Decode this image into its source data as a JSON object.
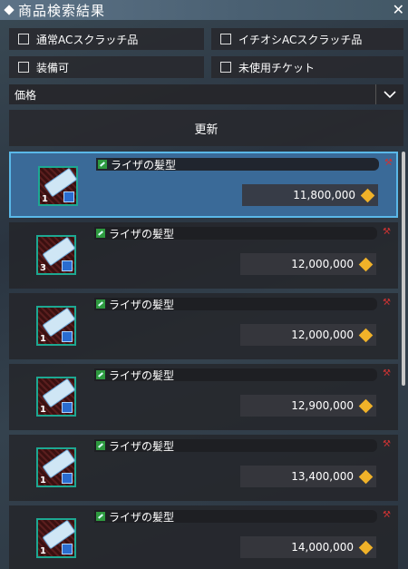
{
  "window": {
    "title": "商品検索結果",
    "close_label": "✕"
  },
  "filters": [
    {
      "label": "通常ACスクラッチ品",
      "checked": false
    },
    {
      "label": "イチオシACスクラッチ品",
      "checked": false
    },
    {
      "label": "装備可",
      "checked": false
    },
    {
      "label": "未使用チケット",
      "checked": false
    }
  ],
  "sort_select": {
    "value": "価格"
  },
  "update_label": "更新",
  "results": [
    {
      "name": "ライザの髪型",
      "qty": "1",
      "price": "11,800,000",
      "selected": true
    },
    {
      "name": "ライザの髪型",
      "qty": "3",
      "price": "12,000,000",
      "selected": false
    },
    {
      "name": "ライザの髪型",
      "qty": "1",
      "price": "12,000,000",
      "selected": false
    },
    {
      "name": "ライザの髪型",
      "qty": "1",
      "price": "12,900,000",
      "selected": false
    },
    {
      "name": "ライザの髪型",
      "qty": "1",
      "price": "13,400,000",
      "selected": false
    },
    {
      "name": "ライザの髪型",
      "qty": "1",
      "price": "14,000,000",
      "selected": false
    }
  ],
  "icons": {
    "window": "diamond-icon",
    "price": "meseta-coin-icon",
    "item": "ticket-icon",
    "shop": "hammer-icon"
  }
}
